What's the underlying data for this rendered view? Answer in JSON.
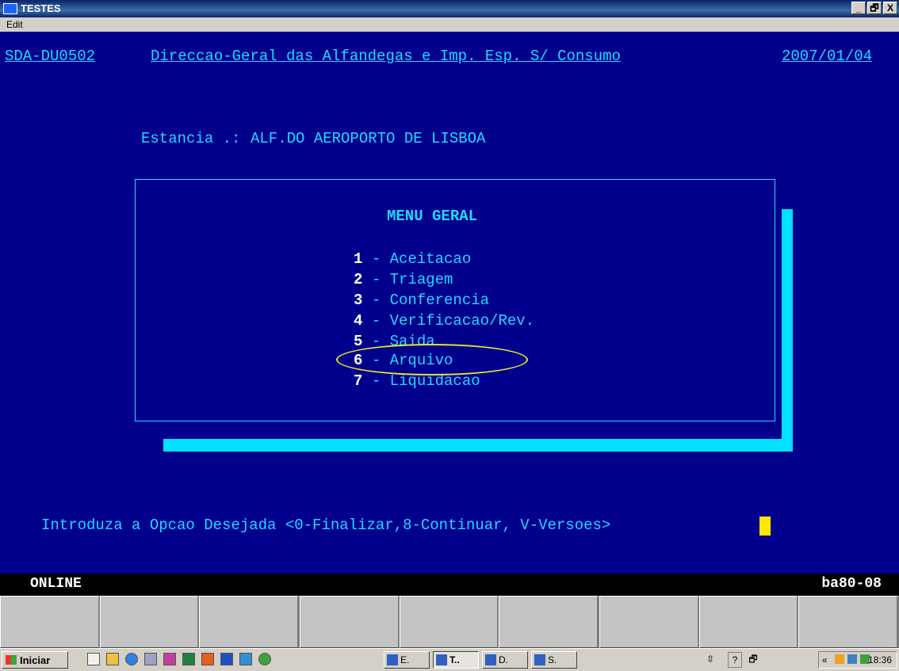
{
  "window": {
    "title": "TESTES",
    "controls": [
      "_",
      "🗗",
      "X"
    ]
  },
  "menubar": {
    "edit": "Edit"
  },
  "terminal": {
    "program_id": "SDA-DU0502",
    "organization": "Direccao-Geral das Alfandegas e Imp. Esp. S/ Consumo",
    "date": "2007/01/04",
    "estancia_label": "Estancia .:",
    "estancia_value": "ALF.DO AEROPORTO DE LISBOA",
    "menu_title": "MENU GERAL",
    "menu_items": [
      {
        "key": "1",
        "label": "- Aceitacao"
      },
      {
        "key": "2",
        "label": "- Triagem"
      },
      {
        "key": "3",
        "label": "- Conferencia"
      },
      {
        "key": "4",
        "label": "- Verificacao/Rev."
      },
      {
        "key": "5",
        "label": "- Saida"
      },
      {
        "key": "6",
        "label": "- Arquivo"
      },
      {
        "key": "7",
        "label": "- Liquidacao"
      }
    ],
    "highlighted_item": "6",
    "prompt": "Introduza a Opcao Desejada <0-Finalizar,8-Continuar, V-Versoes>"
  },
  "status": {
    "left": "ONLINE",
    "right": "ba80-08"
  },
  "taskbar": {
    "start_label": "Iniciar",
    "buttons": [
      "E.",
      "T..",
      "D.",
      "S."
    ],
    "clock": "18:36",
    "tray_prefix": "«"
  },
  "colors": {
    "terminal_bg": "#00008c",
    "terminal_fg": "#22d8ff",
    "highlight_ellipse": "#e8e030",
    "cursor": "#ffe800"
  }
}
